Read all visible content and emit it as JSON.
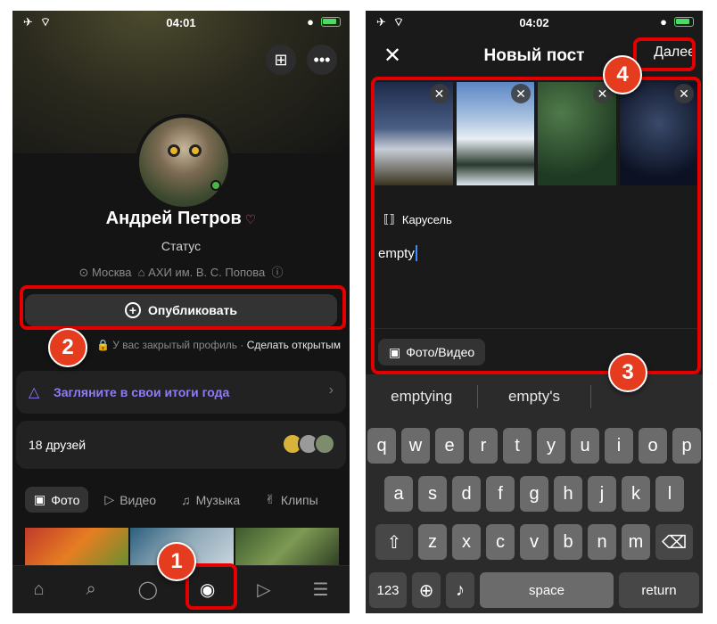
{
  "left_phone": {
    "status_time": "04:01",
    "profile_name": "Андрей Петров",
    "status_text": "Статус",
    "location": "Москва",
    "university": "АХИ им. В. С. Попова",
    "publish_label": "Опубликовать",
    "closed_profile_text": "У вас закрытый профиль",
    "make_open_label": "Сделать открытым",
    "year_summary_label": "Загляните в свои итоги года",
    "friends_label": "18 друзей",
    "tabs": [
      "Фото",
      "Видео",
      "Музыка",
      "Клипы"
    ],
    "nav_icons": [
      "home-icon",
      "search-icon",
      "messages-icon",
      "profile-icon",
      "video-icon",
      "menu-icon"
    ]
  },
  "right_phone": {
    "status_time": "04:02",
    "title": "Новый пост",
    "next_label": "Далее",
    "carousel_label": "Карусель",
    "post_text": "empty",
    "photo_video_label": "Фото/Видео",
    "suggestions": [
      "emptying",
      "empty's",
      ""
    ],
    "keyboard_rows": [
      [
        "q",
        "w",
        "e",
        "r",
        "t",
        "y",
        "u",
        "i",
        "o",
        "p"
      ],
      [
        "a",
        "s",
        "d",
        "f",
        "g",
        "h",
        "j",
        "k",
        "l"
      ],
      [
        "z",
        "x",
        "c",
        "v",
        "b",
        "n",
        "m"
      ]
    ],
    "key_123": "123",
    "key_space": "space",
    "key_return": "return"
  },
  "annotations": {
    "badge_1": "1",
    "badge_2": "2",
    "badge_3": "3",
    "badge_4": "4",
    "highlight_color": "#e40000"
  },
  "colors": {
    "accent_purple": "#8e7cf6",
    "online_green": "#4bb34b",
    "cursor_blue": "#3d8bff"
  }
}
